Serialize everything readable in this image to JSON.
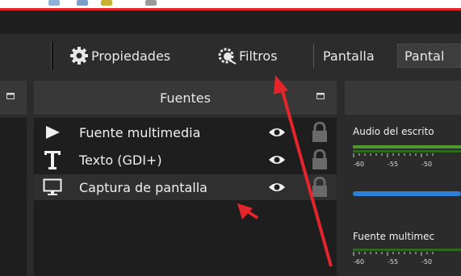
{
  "colors": {
    "accent_red": "#e4252b",
    "meter_green": "#4c9a2e",
    "slider_blue": "#2e7fd8"
  },
  "toolbar": {
    "properties_label": "Propiedades",
    "filters_label": "Filtros",
    "pantalla_label": "Pantalla",
    "pantalla2_label": "Pantal",
    "properties_icon": "gear-icon",
    "filters_icon": "filter-icon"
  },
  "sources_panel": {
    "title": "Fuentes",
    "items": [
      {
        "label": "Fuente multimedia",
        "icon": "play-icon",
        "visible": true,
        "locked": true
      },
      {
        "label": "Texto (GDI+)",
        "icon": "text-icon",
        "visible": true,
        "locked": true
      },
      {
        "label": "Captura de pantalla",
        "icon": "monitor-icon",
        "visible": true,
        "locked": true,
        "selected": true
      }
    ]
  },
  "mixer": {
    "channels": [
      {
        "name": "Audio del escrito"
      },
      {
        "name": "Fuente multimec"
      }
    ],
    "ticks": [
      "-60",
      "-55",
      "-50"
    ]
  }
}
